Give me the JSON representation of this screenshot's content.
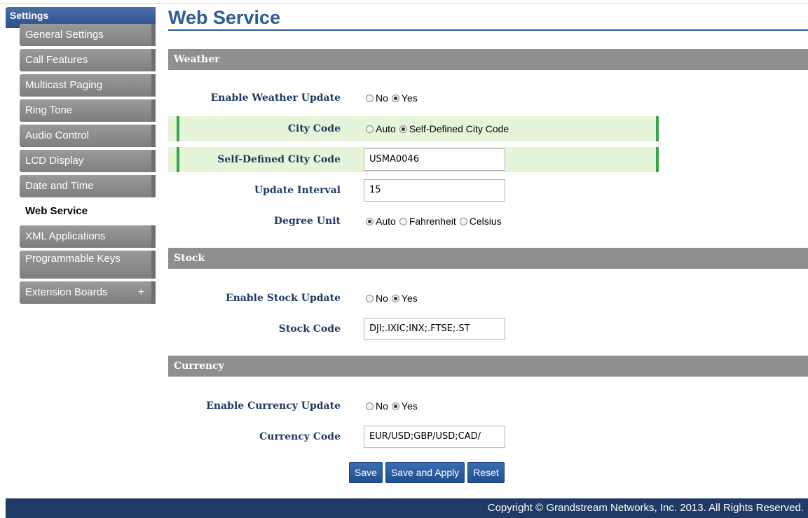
{
  "sidebar": {
    "header": "Settings",
    "items": [
      {
        "label": "General Settings"
      },
      {
        "label": "Call Features"
      },
      {
        "label": "Multicast Paging"
      },
      {
        "label": "Ring Tone"
      },
      {
        "label": "Audio Control"
      },
      {
        "label": "LCD Display"
      },
      {
        "label": "Date and Time"
      },
      {
        "label": "Web Service"
      },
      {
        "label": "XML Applications"
      },
      {
        "label": "Programmable Keys"
      },
      {
        "label": "Extension Boards",
        "expand": "+"
      }
    ]
  },
  "page": {
    "title": "Web Service"
  },
  "weather": {
    "section": "Weather",
    "enable": {
      "label": "Enable Weather Update",
      "options": [
        "No",
        "Yes"
      ],
      "selected": "Yes"
    },
    "city_code": {
      "label": "City Code",
      "options": [
        "Auto",
        "Self-Defined City Code"
      ],
      "selected": "Self-Defined City Code"
    },
    "self_city": {
      "label": "Self-Defined City Code",
      "value": "USMA0046"
    },
    "interval": {
      "label": "Update Interval",
      "value": "15"
    },
    "degree": {
      "label": "Degree Unit",
      "options": [
        "Auto",
        "Fahrenheit",
        "Celsius"
      ],
      "selected": "Auto"
    }
  },
  "stock": {
    "section": "Stock",
    "enable": {
      "label": "Enable Stock Update",
      "options": [
        "No",
        "Yes"
      ],
      "selected": "Yes"
    },
    "code": {
      "label": "Stock Code",
      "value": "DJI;.IXIC;INX;.FTSE;.ST"
    }
  },
  "currency": {
    "section": "Currency",
    "enable": {
      "label": "Enable Currency Update",
      "options": [
        "No",
        "Yes"
      ],
      "selected": "Yes"
    },
    "code": {
      "label": "Currency Code",
      "value": "EUR/USD;GBP/USD;CAD/"
    }
  },
  "buttons": {
    "save": "Save",
    "save_apply": "Save and Apply",
    "reset": "Reset"
  },
  "footer": {
    "text": "Copyright © Grandstream Networks, Inc. 2013. All Rights Reserved."
  },
  "colors": {
    "title": "#2d5c93",
    "highlight": "#e6f5d9",
    "highlight_border": "#37a44a",
    "section_bar": "#8f8f8f",
    "footer": "#1f3a66"
  }
}
